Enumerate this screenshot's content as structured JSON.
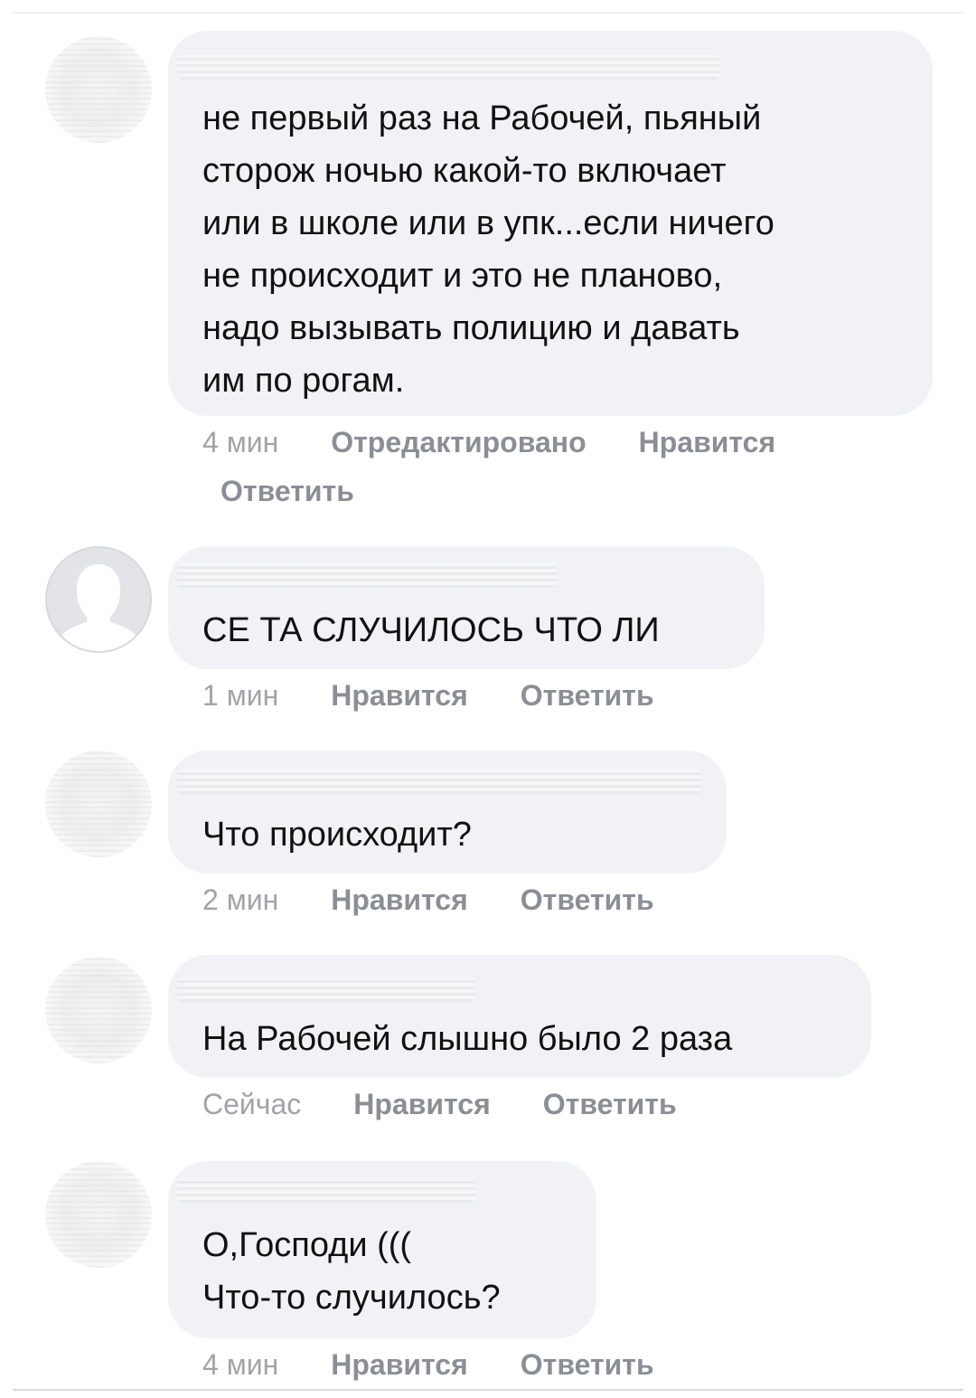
{
  "comments": [
    {
      "text": "не первый раз на Рабочей, пьяный\nсторож ночью какой-то включает\nили в школе или в упк...если ничего\nне происходит и это не планово,\nнадо вызывать полицию и давать\nим по рогам.",
      "time": "4 мин",
      "edited": "Отредактировано",
      "like": "Нравится",
      "reply": "Ответить"
    },
    {
      "text": "СЕ ТА СЛУЧИЛОСЬ ЧТО ЛИ",
      "time": "1 мин",
      "like": "Нравится",
      "reply": "Ответить"
    },
    {
      "text": "Что происходит?",
      "time": "2 мин",
      "like": "Нравится",
      "reply": "Ответить"
    },
    {
      "text": "На Рабочей слышно было 2 раза",
      "time": "Сейчас",
      "like": "Нравится",
      "reply": "Ответить"
    },
    {
      "text": "О,Господи (((\nЧто-то случилось?",
      "time": "4 мин",
      "like": "Нравится",
      "reply": "Ответить"
    }
  ],
  "icons": {
    "default_avatar": "person-silhouette-icon"
  },
  "colors": {
    "bubble": "#f0f2f5",
    "text": "#111111",
    "meta": "#8f9399"
  }
}
